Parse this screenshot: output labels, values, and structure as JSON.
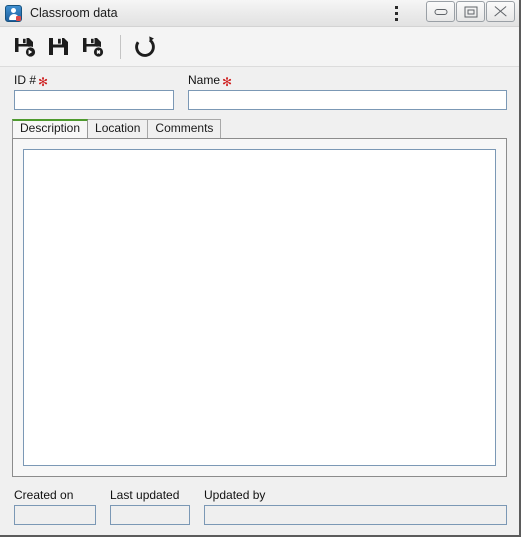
{
  "window": {
    "title": "Classroom data",
    "icon": "app-user-icon",
    "controls": {
      "menu_label": "⋮",
      "minimize_label": "Minimize",
      "restore_label": "Restore",
      "close_label": "Close"
    }
  },
  "toolbar": {
    "buttons": [
      {
        "name": "save-and-new-button",
        "icon": "save-add-icon",
        "label": "Save and new"
      },
      {
        "name": "save-button",
        "icon": "save-icon",
        "label": "Save"
      },
      {
        "name": "save-and-close-button",
        "icon": "save-close-icon",
        "label": "Save and close"
      },
      {
        "name": "refresh-button",
        "icon": "refresh-icon",
        "label": "Refresh"
      }
    ]
  },
  "form": {
    "id_field": {
      "label": "ID #",
      "required_marker": "✻",
      "value": "",
      "placeholder": ""
    },
    "name_field": {
      "label": "Name",
      "required_marker": "✻",
      "value": "",
      "placeholder": ""
    }
  },
  "tabs": {
    "items": [
      {
        "label": "Description",
        "active": true
      },
      {
        "label": "Location",
        "active": false
      },
      {
        "label": "Comments",
        "active": false
      }
    ],
    "active_index": 0
  },
  "description_panel": {
    "textarea_value": "",
    "textarea_placeholder": ""
  },
  "footer": {
    "created_on": {
      "label": "Created on",
      "value": "",
      "disabled": true
    },
    "last_updated": {
      "label": "Last updated",
      "value": "",
      "disabled": true
    },
    "updated_by": {
      "label": "Updated by",
      "value": "",
      "disabled": true
    }
  },
  "colors": {
    "accent_green": "#4e9a2e",
    "required_red": "#cf2222",
    "field_border": "#7b98b5",
    "window_bg": "#f0f0f0",
    "title_icon_blue": "#1d5f9e"
  }
}
